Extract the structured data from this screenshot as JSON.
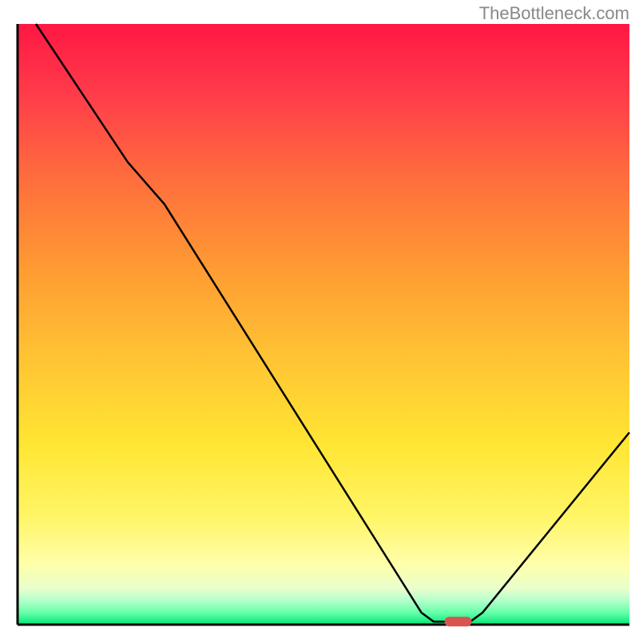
{
  "watermark": "TheBottleneck.com",
  "chart_data": {
    "type": "line",
    "title": "",
    "xlabel": "",
    "ylabel": "",
    "xlim": [
      0,
      100
    ],
    "ylim": [
      0,
      100
    ],
    "background": {
      "type": "vertical_gradient",
      "stops": [
        {
          "pos": 0.0,
          "color": "#ff1744"
        },
        {
          "pos": 0.12,
          "color": "#ff3d4a"
        },
        {
          "pos": 0.25,
          "color": "#ff6b3d"
        },
        {
          "pos": 0.4,
          "color": "#ff9933"
        },
        {
          "pos": 0.55,
          "color": "#ffc233"
        },
        {
          "pos": 0.7,
          "color": "#ffe633"
        },
        {
          "pos": 0.82,
          "color": "#fff566"
        },
        {
          "pos": 0.9,
          "color": "#ffffaa"
        },
        {
          "pos": 0.94,
          "color": "#e8ffcc"
        },
        {
          "pos": 0.96,
          "color": "#b3ffcc"
        },
        {
          "pos": 0.98,
          "color": "#66ffaa"
        },
        {
          "pos": 1.0,
          "color": "#00e676"
        }
      ]
    },
    "series": [
      {
        "name": "curve",
        "color": "#000000",
        "points": [
          {
            "x": 3,
            "y": 100
          },
          {
            "x": 18,
            "y": 77
          },
          {
            "x": 24,
            "y": 70
          },
          {
            "x": 66,
            "y": 2
          },
          {
            "x": 68,
            "y": 0.5
          },
          {
            "x": 74,
            "y": 0.5
          },
          {
            "x": 76,
            "y": 2
          },
          {
            "x": 100,
            "y": 32
          }
        ]
      }
    ],
    "marker": {
      "x": 72,
      "y": 0.5,
      "color": "#d9534f",
      "shape": "rounded_rect"
    },
    "border": {
      "left": true,
      "bottom": true,
      "top": false,
      "right": false,
      "color": "#000000",
      "width": 3
    }
  }
}
